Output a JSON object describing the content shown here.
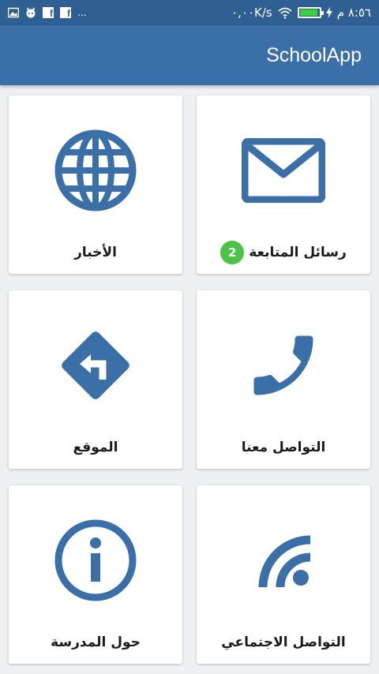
{
  "status_bar": {
    "time": "٨:٥٦ م",
    "net_speed": "٠,٠٠K/s",
    "dots": "…"
  },
  "app_bar": {
    "title": "SchoolApp"
  },
  "colors": {
    "primary": "#3a6fa8",
    "status": "#2f5f93",
    "icon": "#3a6fa8",
    "badge": "#4cc246"
  },
  "tiles": [
    {
      "label": "رسائل المتابعة",
      "icon": "mail-icon",
      "badge": "2"
    },
    {
      "label": "الأخبار",
      "icon": "globe-icon"
    },
    {
      "label": "التواصل معنا",
      "icon": "phone-icon"
    },
    {
      "label": "الموقع",
      "icon": "directions-icon"
    },
    {
      "label": "التواصل الاجتماعي",
      "icon": "rss-icon"
    },
    {
      "label": "حول المدرسة",
      "icon": "info-icon"
    }
  ]
}
